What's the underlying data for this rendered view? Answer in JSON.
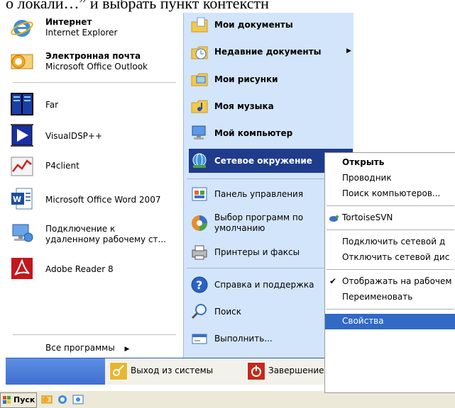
{
  "top_text": "о локали…” и выбрать пункт контекстн",
  "left_pinned": [
    {
      "title": "Интернет",
      "subtitle": "Internet Explorer",
      "icon": "internet-explorer-icon"
    },
    {
      "title": "Электронная почта",
      "subtitle": "Microsoft Office Outlook",
      "icon": "outlook-icon"
    }
  ],
  "left_recent": [
    {
      "label": "Far",
      "icon": "far-manager-icon"
    },
    {
      "label": "VisualDSP++",
      "icon": "visualdsp-icon"
    },
    {
      "label": "P4client",
      "icon": "p4client-icon"
    },
    {
      "label": "Microsoft Office Word 2007",
      "icon": "word-icon"
    },
    {
      "label1": "Подключение к",
      "label2": "удаленному рабочему ст...",
      "icon": "remote-desktop-icon"
    },
    {
      "label": "Adobe Reader 8",
      "icon": "adobe-reader-icon"
    }
  ],
  "all_programs": "Все программы",
  "right_items": [
    {
      "label": "Мои документы",
      "bold": true,
      "icon": "my-documents-icon"
    },
    {
      "label": "Недавние документы",
      "bold": true,
      "icon": "recent-documents-icon",
      "arrow": true
    },
    {
      "label": "Мои рисунки",
      "bold": true,
      "icon": "my-pictures-icon"
    },
    {
      "label": "Моя музыка",
      "bold": true,
      "icon": "my-music-icon"
    },
    {
      "label": "Мой компьютер",
      "bold": true,
      "icon": "my-computer-icon"
    },
    {
      "label": "Сетевое окружение",
      "bold": true,
      "icon": "network-places-icon",
      "selected": true
    },
    {
      "label": "Панель управления",
      "icon": "control-panel-icon"
    },
    {
      "label1": "Выбор программ по",
      "label2": "умолчанию",
      "icon": "default-programs-icon"
    },
    {
      "label": "Принтеры и факсы",
      "icon": "printers-icon"
    },
    {
      "label": "Справка и поддержка",
      "icon": "help-icon"
    },
    {
      "label": "Поиск",
      "icon": "search-icon"
    },
    {
      "label": "Выполнить...",
      "icon": "run-icon"
    }
  ],
  "bottom": {
    "logout": "Выход из системы",
    "shutdown": "Завершение работы"
  },
  "taskbar": {
    "start": "Пуск"
  },
  "context_menu": [
    {
      "label": "Открыть",
      "bold": true
    },
    {
      "label": "Проводник"
    },
    {
      "label": "Поиск компьютеров..."
    },
    {
      "label": "TortoiseSVN",
      "icon": "tortoisesvn-icon"
    },
    {
      "label": "Подключить сетевой д"
    },
    {
      "label": "Отключить сетевой дис"
    },
    {
      "label": "Отображать на рабочем",
      "checked": true
    },
    {
      "label": "Переименовать"
    },
    {
      "label": "Свойства",
      "selected": true
    }
  ],
  "colors": {
    "right_panel": "#d3e5fa",
    "selection": "#1f3b8c",
    "context_selection": "#316ac5"
  }
}
